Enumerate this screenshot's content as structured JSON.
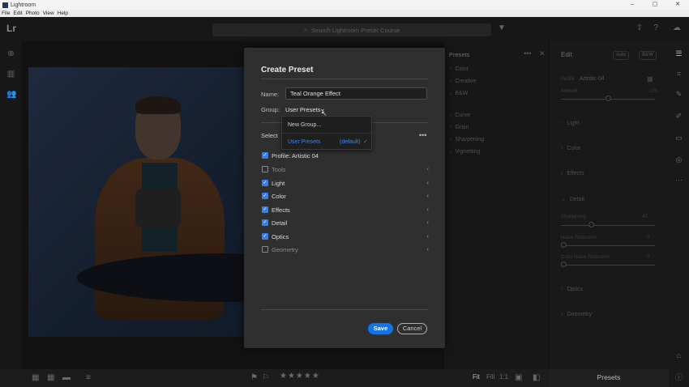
{
  "window": {
    "title": "Lightroom",
    "controls": [
      "–",
      "▢",
      "✕"
    ]
  },
  "menu": [
    "File",
    "Edit",
    "Photo",
    "View",
    "Help"
  ],
  "topbar": {
    "logo": "Lr",
    "search_placeholder": "Search Lightroom Preset Course"
  },
  "presets_panel": {
    "title": "Presets",
    "items": [
      "Color",
      "Creative",
      "B&W",
      "Curve",
      "Grain",
      "Sharpening",
      "Vignetting"
    ]
  },
  "edit_panel": {
    "title": "Edit",
    "auto_label": "Auto",
    "bw_label": "B&W",
    "profile_label": "Profile",
    "profile_value": "Artistic 04",
    "amount_label": "Amount",
    "amount_value": "100",
    "sections": [
      "Light",
      "Color",
      "Effects",
      "Detail",
      "Optics",
      "Geometry"
    ],
    "sharpening_label": "Sharpening",
    "sharpening_value": "47",
    "noise_label": "Noise Reduction",
    "noise_value": "0",
    "color_noise_label": "Color Noise Reduction",
    "color_noise_value": "0"
  },
  "bottom": {
    "fit": "Fit",
    "fill": "Fill",
    "one_to_one": "1:1",
    "presets": "Presets",
    "stars": "★★★★★"
  },
  "dialog": {
    "title": "Create Preset",
    "name_label": "Name:",
    "name_value": "Teal Orange Effect",
    "group_label": "Group:",
    "group_value": "User Presets",
    "select_label": "Select",
    "more": "•••",
    "rows": [
      {
        "label": "Profile: Artistic 04",
        "checked": true,
        "chevron": false
      },
      {
        "label": "Tools",
        "checked": false,
        "chevron": true
      },
      {
        "label": "Light",
        "checked": true,
        "chevron": true
      },
      {
        "label": "Color",
        "checked": true,
        "chevron": true
      },
      {
        "label": "Effects",
        "checked": true,
        "chevron": true
      },
      {
        "label": "Detail",
        "checked": true,
        "chevron": true
      },
      {
        "label": "Optics",
        "checked": true,
        "chevron": true
      },
      {
        "label": "Geometry",
        "checked": false,
        "chevron": true
      }
    ],
    "save": "Save",
    "cancel": "Cancel"
  },
  "dropdown": {
    "new_group": "New Group...",
    "selected_item": "User Presets",
    "default_tag": "(default)"
  },
  "colors": {
    "accent": "#1473e6",
    "link": "#3d88e8",
    "dialog_bg": "#2f2f2f"
  }
}
